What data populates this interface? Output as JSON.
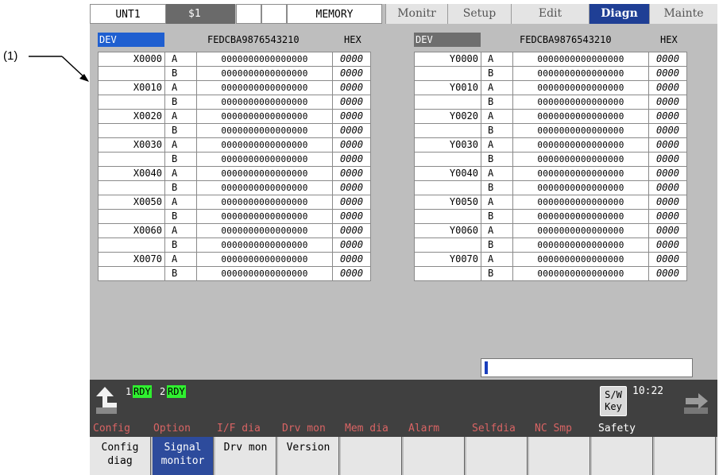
{
  "annotation": "(1)",
  "top_bar": {
    "unit": "UNT1",
    "system": "$1",
    "mode": "MEMORY",
    "tabs": [
      "Monitr",
      "Setup",
      "Edit",
      "Diagn",
      "Mainte"
    ],
    "active_tab": "Diagn"
  },
  "left_panel": {
    "dev_label": "DEV",
    "bit_header": "FEDCBA9876543210",
    "hex_header": "HEX",
    "rows": [
      {
        "addr": "X0000",
        "ab": "A",
        "bits": "0000000000000000",
        "hex": "0000"
      },
      {
        "addr": "",
        "ab": "B",
        "bits": "0000000000000000",
        "hex": "0000"
      },
      {
        "addr": "X0010",
        "ab": "A",
        "bits": "0000000000000000",
        "hex": "0000"
      },
      {
        "addr": "",
        "ab": "B",
        "bits": "0000000000000000",
        "hex": "0000"
      },
      {
        "addr": "X0020",
        "ab": "A",
        "bits": "0000000000000000",
        "hex": "0000"
      },
      {
        "addr": "",
        "ab": "B",
        "bits": "0000000000000000",
        "hex": "0000"
      },
      {
        "addr": "X0030",
        "ab": "A",
        "bits": "0000000000000000",
        "hex": "0000"
      },
      {
        "addr": "",
        "ab": "B",
        "bits": "0000000000000000",
        "hex": "0000"
      },
      {
        "addr": "X0040",
        "ab": "A",
        "bits": "0000000000000000",
        "hex": "0000"
      },
      {
        "addr": "",
        "ab": "B",
        "bits": "0000000000000000",
        "hex": "0000"
      },
      {
        "addr": "X0050",
        "ab": "A",
        "bits": "0000000000000000",
        "hex": "0000"
      },
      {
        "addr": "",
        "ab": "B",
        "bits": "0000000000000000",
        "hex": "0000"
      },
      {
        "addr": "X0060",
        "ab": "A",
        "bits": "0000000000000000",
        "hex": "0000"
      },
      {
        "addr": "",
        "ab": "B",
        "bits": "0000000000000000",
        "hex": "0000"
      },
      {
        "addr": "X0070",
        "ab": "A",
        "bits": "0000000000000000",
        "hex": "0000"
      },
      {
        "addr": "",
        "ab": "B",
        "bits": "0000000000000000",
        "hex": "0000"
      }
    ]
  },
  "right_panel": {
    "dev_label": "DEV",
    "bit_header": "FEDCBA9876543210",
    "hex_header": "HEX",
    "rows": [
      {
        "addr": "Y0000",
        "ab": "A",
        "bits": "0000000000000000",
        "hex": "0000"
      },
      {
        "addr": "",
        "ab": "B",
        "bits": "0000000000000000",
        "hex": "0000"
      },
      {
        "addr": "Y0010",
        "ab": "A",
        "bits": "0000000000000000",
        "hex": "0000"
      },
      {
        "addr": "",
        "ab": "B",
        "bits": "0000000000000000",
        "hex": "0000"
      },
      {
        "addr": "Y0020",
        "ab": "A",
        "bits": "0000000000000000",
        "hex": "0000"
      },
      {
        "addr": "",
        "ab": "B",
        "bits": "0000000000000000",
        "hex": "0000"
      },
      {
        "addr": "Y0030",
        "ab": "A",
        "bits": "0000000000000000",
        "hex": "0000"
      },
      {
        "addr": "",
        "ab": "B",
        "bits": "0000000000000000",
        "hex": "0000"
      },
      {
        "addr": "Y0040",
        "ab": "A",
        "bits": "0000000000000000",
        "hex": "0000"
      },
      {
        "addr": "",
        "ab": "B",
        "bits": "0000000000000000",
        "hex": "0000"
      },
      {
        "addr": "Y0050",
        "ab": "A",
        "bits": "0000000000000000",
        "hex": "0000"
      },
      {
        "addr": "",
        "ab": "B",
        "bits": "0000000000000000",
        "hex": "0000"
      },
      {
        "addr": "Y0060",
        "ab": "A",
        "bits": "0000000000000000",
        "hex": "0000"
      },
      {
        "addr": "",
        "ab": "B",
        "bits": "0000000000000000",
        "hex": "0000"
      },
      {
        "addr": "Y0070",
        "ab": "A",
        "bits": "0000000000000000",
        "hex": "0000"
      },
      {
        "addr": "",
        "ab": "B",
        "bits": "0000000000000000",
        "hex": "0000"
      }
    ]
  },
  "status": {
    "rdy1_num": "1",
    "rdy1": "RDY",
    "rdy2_num": "2",
    "rdy2": "RDY",
    "sw_key_line1": "S/W",
    "sw_key_line2": "Key",
    "time": "10:22"
  },
  "menu_labels": [
    "Config",
    "Option",
    "I/F dia",
    "Drv mon",
    "Mem dia",
    "Alarm",
    "Selfdia",
    "NC Smp",
    "Safety"
  ],
  "softkeys": [
    {
      "line1": "Config",
      "line2": "diag"
    },
    {
      "line1": "Signal",
      "line2": "monitor"
    },
    {
      "line1": "Drv mon",
      "line2": ""
    },
    {
      "line1": "Version",
      "line2": ""
    },
    {
      "line1": "",
      "line2": ""
    },
    {
      "line1": "",
      "line2": ""
    },
    {
      "line1": "",
      "line2": ""
    },
    {
      "line1": "",
      "line2": ""
    },
    {
      "line1": "",
      "line2": ""
    },
    {
      "line1": "",
      "line2": ""
    }
  ],
  "icons": {
    "back": "up-arrow-icon",
    "next": "right-arrow-icon"
  },
  "colors": {
    "active_tab": "#1f3f95",
    "rdy_green": "#2ff02f",
    "menu_inactive": "#d96464",
    "selected_softkey": "#2d4b9c"
  }
}
